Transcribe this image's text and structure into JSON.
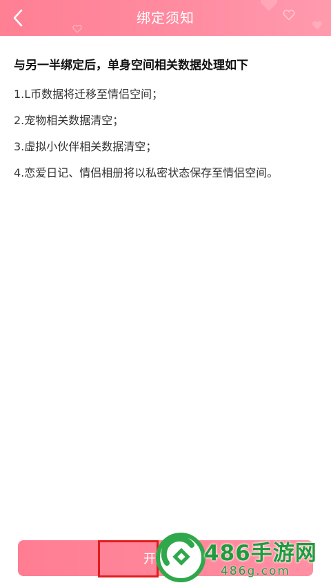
{
  "header": {
    "title": "绑定须知",
    "back_icon": "chevron-left-icon",
    "bg_color": "#ff8a9d"
  },
  "content": {
    "heading": "与另一半绑定后，单身空间相关数据处理如下",
    "items": [
      "1.L币数据将迁移至情侣空间；",
      "2.宠物相关数据清空；",
      "3.虚拟小伙伴相关数据清空；",
      "4.恋爱日记、情侣相册将以私密状态保存至情侣空间。"
    ]
  },
  "bottom_button": {
    "label": "开始",
    "color": "#ff8598"
  },
  "watermark": {
    "name": "486手游网",
    "url": "486g.com",
    "color": "#1f9c3d"
  }
}
